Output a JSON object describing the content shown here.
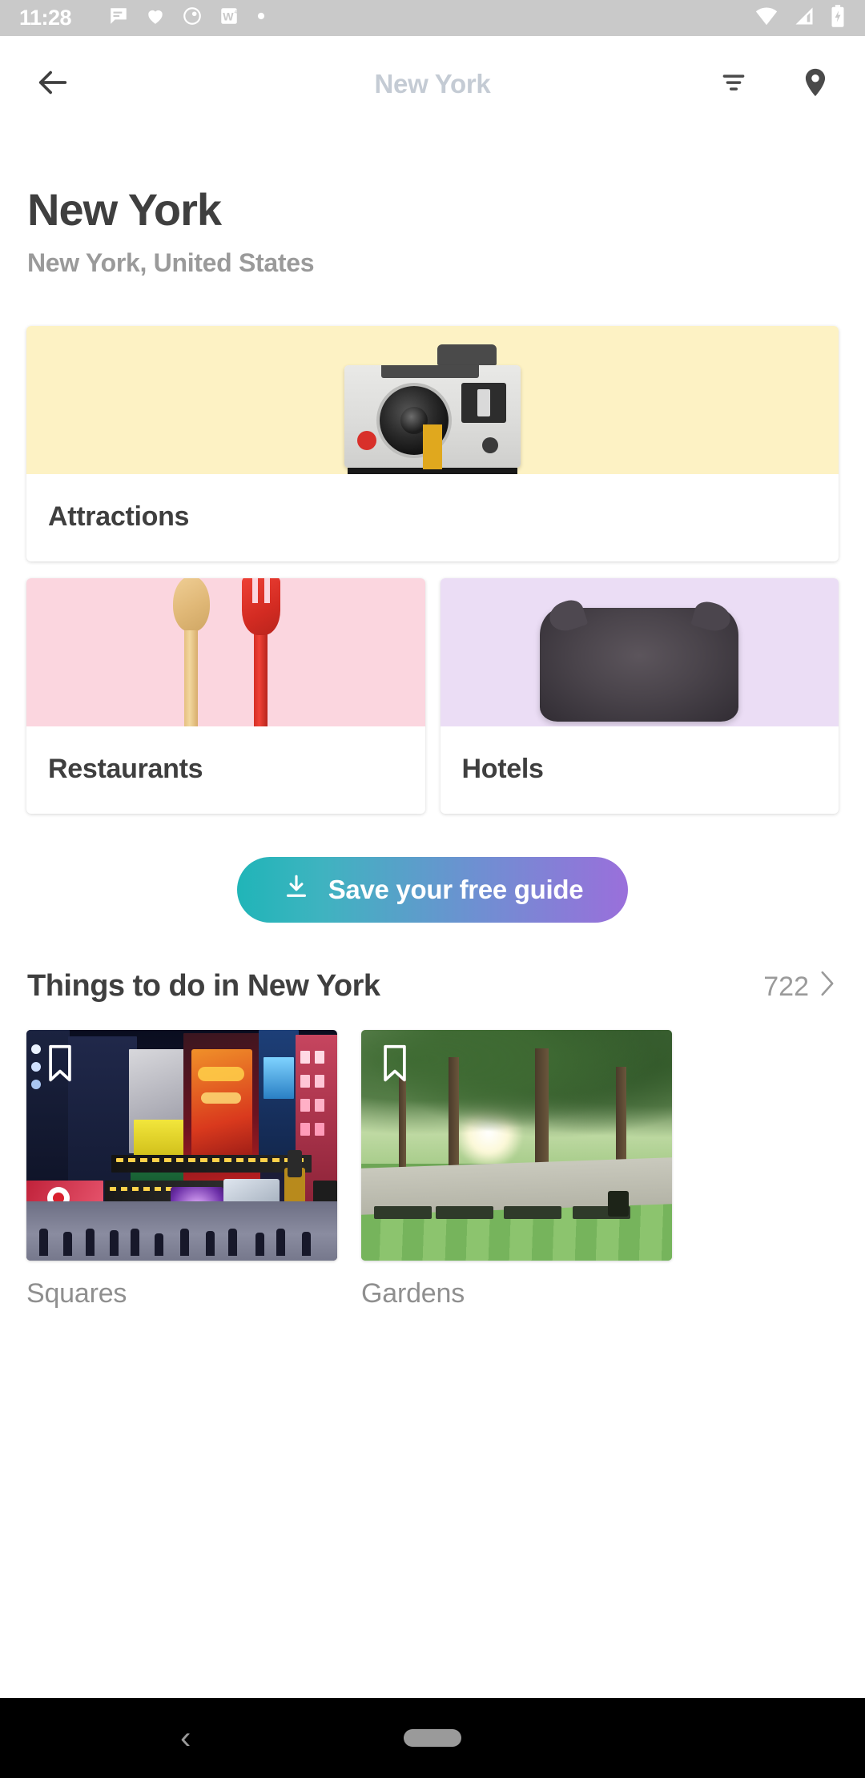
{
  "status_bar": {
    "time": "11:28",
    "left_icons": [
      "message-icon",
      "heart-icon",
      "circle-icon",
      "word-game-icon",
      "dot-icon"
    ],
    "right_icons": [
      "wifi-icon",
      "cellular-signal-icon",
      "battery-charging-icon"
    ],
    "background_color": "#c9c9c9"
  },
  "app_bar": {
    "back_label": "back-arrow",
    "title": "New York",
    "title_color": "#c4cbd4",
    "filter_label": "filter-icon",
    "map_label": "map-pin-icon"
  },
  "page": {
    "title": "New York",
    "subtitle": "New York, United States"
  },
  "categories": [
    {
      "label": "Attractions",
      "image": "polaroid-camera",
      "bg": "#fdf2c4"
    },
    {
      "label": "Restaurants",
      "image": "spoon-and-fork",
      "bg": "#fbd6df"
    },
    {
      "label": "Hotels",
      "image": "pillow",
      "bg": "#ebddf5"
    }
  ],
  "cta": {
    "label": "Save your free guide",
    "icon": "download-icon",
    "gradient_start": "#20b5b8",
    "gradient_end": "#9a6fdb"
  },
  "things_section": {
    "title": "Things to do in New York",
    "count": "722",
    "chevron": "›"
  },
  "tiles": [
    {
      "label": "Squares",
      "image": "times-square-night",
      "bookmark": "bookmark-icon"
    },
    {
      "label": "Gardens",
      "image": "central-park-trees",
      "bookmark": "bookmark-icon"
    }
  ],
  "nav_bar": {
    "back": "‹",
    "home_pill": "home-pill"
  }
}
